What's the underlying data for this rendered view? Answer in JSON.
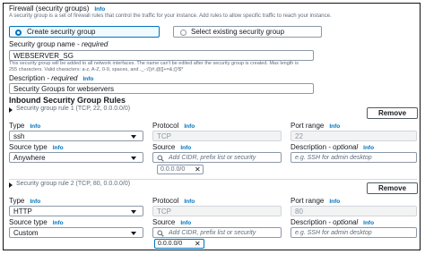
{
  "firewall": {
    "title": "Firewall (security groups)",
    "info": "Info",
    "description": "A security group is a set of firewall rules that control the traffic for your instance. Add rules to allow specific traffic to reach your instance.",
    "option_create": "Create security group",
    "option_select": "Select existing security group",
    "selected": "create"
  },
  "sg_name": {
    "label": "Security group name",
    "required": " - required",
    "value": "WEBSERVER_SG",
    "help_line1": "This security group will be added to all network interfaces. The name can't be edited after the security group is created. Max length is",
    "help_line2": "255 characters. Valid characters: a-z, A-Z, 0-9, spaces, and ._-:/()#,@[]+=&;{}!$*"
  },
  "description": {
    "label": "Description",
    "required": " - required",
    "info": "Info",
    "value": "Security Groups for webservers"
  },
  "inbound": {
    "title": "Inbound Security Group Rules",
    "rules": [
      {
        "heading": "Security group rule 1 (TCP, 22, 0.0.0.0/0)",
        "remove": "Remove",
        "type_label": "Type",
        "type_info": "Info",
        "type_value": "ssh",
        "protocol_label": "Protocol",
        "protocol_info": "Info",
        "protocol_value": "TCP",
        "port_label": "Port range",
        "port_info": "Info",
        "port_value": "22",
        "source_type_label": "Source type",
        "source_type_info": "Info",
        "source_type_value": "Anywhere",
        "source_label": "Source",
        "source_info": "Info",
        "source_placeholder": "Add CIDR, prefix list or security",
        "cidr_token": "0.0.0.0/0",
        "desc_label": "Description",
        "desc_optional": " - optional",
        "desc_info": "Info",
        "desc_placeholder": "e.g. SSH for admin desktop"
      },
      {
        "heading": "Security group rule 2 (TCP, 80, 0.0.0.0/0)",
        "remove": "Remove",
        "type_label": "Type",
        "type_info": "Info",
        "type_value": "HTTP",
        "protocol_label": "Protocol",
        "protocol_info": "Info",
        "protocol_value": "TCP",
        "port_label": "Port range",
        "port_info": "Info",
        "port_value": "80",
        "source_type_label": "Source type",
        "source_type_info": "Info",
        "source_type_value": "Custom",
        "source_label": "Source",
        "source_info": "Info",
        "source_placeholder": "Add CIDR, prefix list or security",
        "cidr_token": "0.0.0.0/0",
        "desc_label": "Description",
        "desc_optional": " - optional",
        "desc_info": "Info",
        "desc_placeholder": "e.g. SSH for admin desktop"
      }
    ]
  },
  "icons": {
    "search": "search-icon",
    "remove_token": "close-icon",
    "dropdown": "caret-down-icon",
    "expand": "expand-triangle-icon"
  },
  "colors": {
    "accent": "#0073bb",
    "border": "#8d99a8",
    "text": "#16191f",
    "muted": "#5f6b7a"
  }
}
